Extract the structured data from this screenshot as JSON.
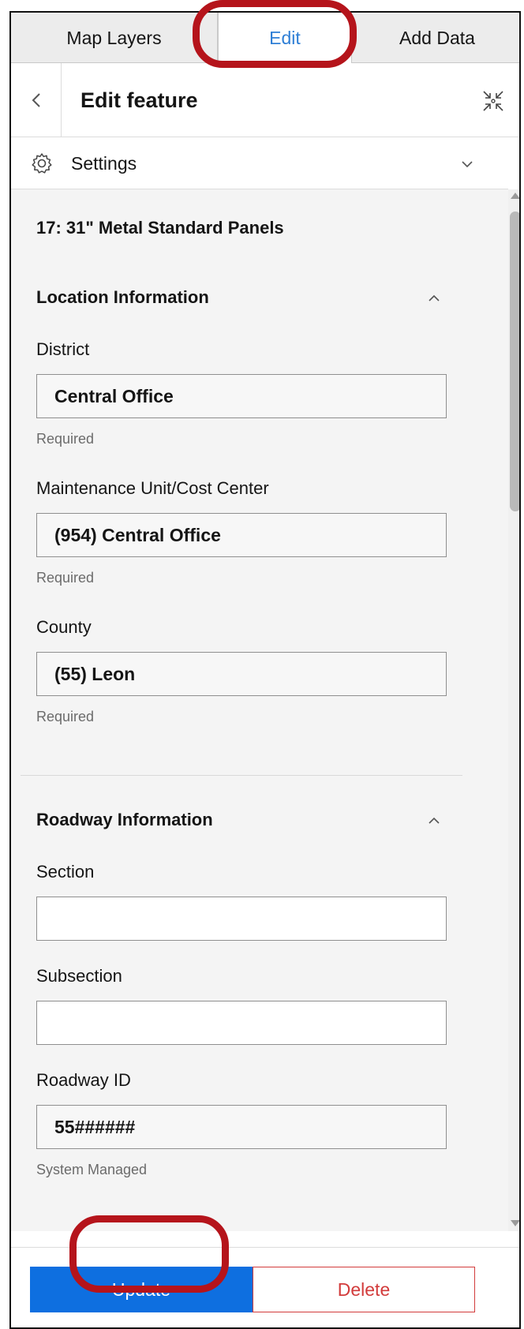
{
  "tabs": [
    {
      "label": "Map Layers"
    },
    {
      "label": "Edit"
    },
    {
      "label": "Add Data"
    }
  ],
  "header": {
    "back_glyph": "<",
    "title": "Edit feature"
  },
  "settings": {
    "label": "Settings"
  },
  "feature": {
    "title": "17: 31\" Metal Standard Panels"
  },
  "sections": [
    {
      "heading": "Location Information",
      "fields": [
        {
          "label": "District",
          "value": "Central Office",
          "hint": "Required"
        },
        {
          "label": "Maintenance Unit/Cost Center",
          "value": "(954) Central Office",
          "hint": "Required"
        },
        {
          "label": "County",
          "value": "(55) Leon",
          "hint": "Required"
        }
      ]
    },
    {
      "heading": "Roadway Information",
      "fields": [
        {
          "label": "Section",
          "value": ""
        },
        {
          "label": "Subsection",
          "value": ""
        },
        {
          "label": "Roadway ID",
          "value": "55######",
          "hint": "System Managed"
        }
      ]
    }
  ],
  "footer": {
    "update_label": "Update",
    "delete_label": "Delete"
  },
  "colors": {
    "accent": "#2f7fd6",
    "primary_button": "#0e6fe0",
    "danger": "#d23b3b",
    "highlight_ring": "#b5141b"
  }
}
